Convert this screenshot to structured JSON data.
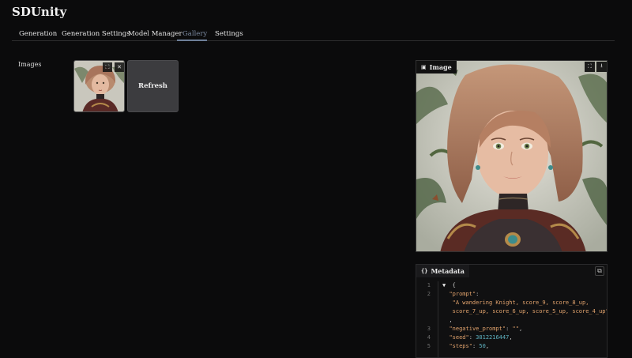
{
  "app": {
    "title": "SDUnity"
  },
  "tabs": [
    {
      "label": "Generation"
    },
    {
      "label": "Generation Settings"
    },
    {
      "label": "Model Manager"
    },
    {
      "label": "Gallery",
      "active": true
    },
    {
      "label": "Settings"
    }
  ],
  "gallery": {
    "images_label": "Images",
    "refresh_label": "Refresh"
  },
  "image_panel": {
    "label": "Image"
  },
  "metadata": {
    "label": "Metadata",
    "line_numbers": [
      "1",
      "2",
      "",
      "",
      "",
      "3",
      "4",
      "5"
    ],
    "json": {
      "prompt": "A wandering Knight, score_9, score_8_up, score_7_up, score_6_up, score_5_up, score_4_up",
      "negative_prompt": "",
      "seed": 3812216447,
      "steps": 50
    }
  },
  "colors": {
    "accent": "#6e7f99",
    "bg": "#0b0b0c",
    "json_key": "#e2a36d",
    "json_number": "#5fb3c2"
  },
  "icons": [
    "fullscreen-icon",
    "close-icon",
    "image-icon",
    "download-icon",
    "code-braces-icon",
    "copy-icon"
  ]
}
